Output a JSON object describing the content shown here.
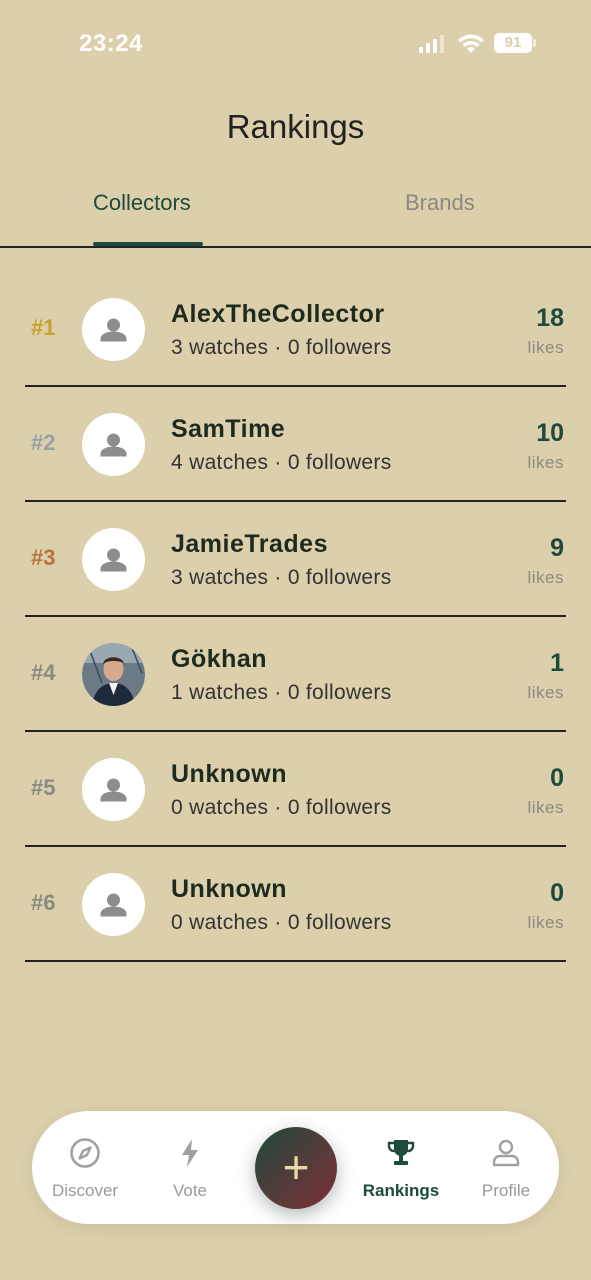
{
  "status_bar": {
    "time": "23:24",
    "battery": "91"
  },
  "header": {
    "title": "Rankings"
  },
  "tabs": [
    {
      "label": "Collectors",
      "active": true
    },
    {
      "label": "Brands",
      "active": false
    }
  ],
  "rankings": [
    {
      "rank": "#1",
      "name": "AlexTheCollector",
      "meta": "3 watches · 0 followers",
      "likes": "18",
      "likes_label": "likes",
      "rank_color": "#c9a227",
      "avatar": "placeholder"
    },
    {
      "rank": "#2",
      "name": "SamTime",
      "meta": "4 watches · 0 followers",
      "likes": "10",
      "likes_label": "likes",
      "rank_color": "#9aa0a6",
      "avatar": "placeholder"
    },
    {
      "rank": "#3",
      "name": "JamieTrades",
      "meta": "3 watches · 0 followers",
      "likes": "9",
      "likes_label": "likes",
      "rank_color": "#b8743a",
      "avatar": "placeholder"
    },
    {
      "rank": "#4",
      "name": "Gökhan",
      "meta": "1 watches · 0 followers",
      "likes": "1",
      "likes_label": "likes",
      "rank_color": "#8a8a80",
      "avatar": "photo"
    },
    {
      "rank": "#5",
      "name": "Unknown",
      "meta": "0 watches · 0 followers",
      "likes": "0",
      "likes_label": "likes",
      "rank_color": "#8a8a80",
      "avatar": "placeholder"
    },
    {
      "rank": "#6",
      "name": "Unknown",
      "meta": "0 watches · 0 followers",
      "likes": "0",
      "likes_label": "likes",
      "rank_color": "#8a8a80",
      "avatar": "placeholder"
    }
  ],
  "bottom_nav": {
    "items": [
      {
        "label": "Discover",
        "icon": "compass-icon",
        "active": false
      },
      {
        "label": "Vote",
        "icon": "bolt-icon",
        "active": false
      },
      {
        "label": "Rankings",
        "icon": "trophy-icon",
        "active": true
      },
      {
        "label": "Profile",
        "icon": "person-icon",
        "active": false
      }
    ],
    "add_button": "+"
  },
  "colors": {
    "background": "#dccfab",
    "accent": "#1d4a3a",
    "gold": "#c9a227",
    "silver": "#9aa0a6",
    "bronze": "#b8743a"
  }
}
